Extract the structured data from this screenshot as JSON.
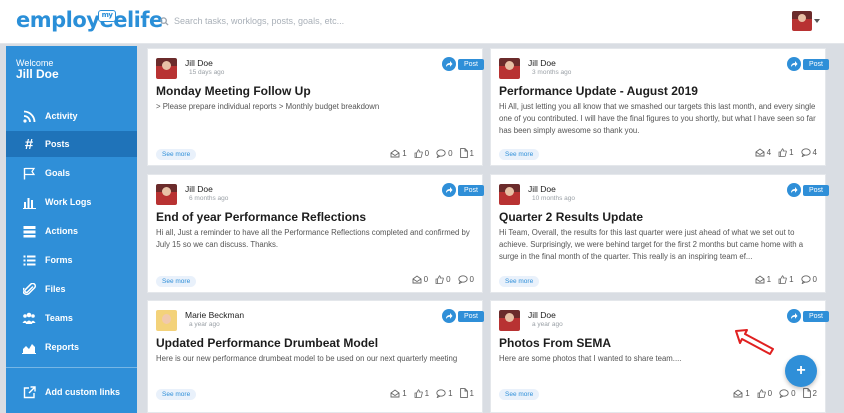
{
  "header": {
    "logo_text": "employeelife",
    "logo_badge": "my",
    "search_placeholder": "Search tasks, worklogs, posts, goals, etc..."
  },
  "sidebar": {
    "welcome_label": "Welcome",
    "user_name": "Jill Doe",
    "items": [
      {
        "label": "Activity",
        "icon": "signal-icon"
      },
      {
        "label": "Posts",
        "icon": "hashtag-icon"
      },
      {
        "label": "Goals",
        "icon": "flag-icon"
      },
      {
        "label": "Work Logs",
        "icon": "bar-chart-icon"
      },
      {
        "label": "Actions",
        "icon": "actions-icon"
      },
      {
        "label": "Forms",
        "icon": "list-icon"
      },
      {
        "label": "Files",
        "icon": "paperclip-icon"
      },
      {
        "label": "Teams",
        "icon": "team-icon"
      },
      {
        "label": "Reports",
        "icon": "area-chart-icon"
      }
    ],
    "custom_links_label": "Add custom links"
  },
  "posts": [
    {
      "author": "Jill Doe",
      "ago": "15 days ago",
      "badge": "Post",
      "title": "Monday Meeting Follow Up",
      "excerpt": "> Please prepare individual reports > Monthly budget breakdown",
      "see_more": "See more",
      "views": "1",
      "likes": "0",
      "comments": "0",
      "files": "1"
    },
    {
      "author": "Jill Doe",
      "ago": "3 months ago",
      "badge": "Post",
      "title": "Performance Update - August 2019",
      "excerpt": "Hi All, just letting you all know that we smashed our targets this last month, and every single one of you contributed. I will have the final figures to you shortly, but what I have seen so far has been simply awesome so thank you.",
      "see_more": "See more",
      "views": "4",
      "likes": "1",
      "comments": "4"
    },
    {
      "author": "Jill Doe",
      "ago": "6 months ago",
      "badge": "Post",
      "title": "End of year Performance Reflections",
      "excerpt": "Hi all, Just a reminder to have all the Performance Reflections completed and confirmed by July 15 so we can discuss. Thanks.",
      "see_more": "See more",
      "views": "0",
      "likes": "0",
      "comments": "0"
    },
    {
      "author": "Jill Doe",
      "ago": "10 months ago",
      "badge": "Post",
      "title": "Quarter 2 Results Update",
      "excerpt": "Hi Team, Overall, the results for this last quarter were just ahead of what we set out to achieve. Surprisingly, we were behind target for the first 2 months but came home with a surge in the final month of the quarter. This really is an inspiring team ef...",
      "see_more": "See more",
      "views": "1",
      "likes": "1",
      "comments": "0"
    },
    {
      "author": "Marie Beckman",
      "ago": "a year ago",
      "badge": "Post",
      "title": "Updated Performance Drumbeat Model",
      "excerpt": "Here is our new performance drumbeat model to be used on our next quarterly meeting",
      "see_more": "See more",
      "views": "1",
      "likes": "1",
      "comments": "1",
      "files": "1"
    },
    {
      "author": "Jill Doe",
      "ago": "a year ago",
      "badge": "Post",
      "title": "Photos From SEMA",
      "excerpt": "Here are some photos that I wanted to share team....",
      "see_more": "See more",
      "views": "1",
      "likes": "0",
      "comments": "0",
      "files": "2"
    }
  ],
  "fab_label": "+",
  "colors": {
    "accent": "#2f8fd8",
    "sidebar_active": "#1f73b9",
    "annotation_arrow": "#e02020"
  }
}
